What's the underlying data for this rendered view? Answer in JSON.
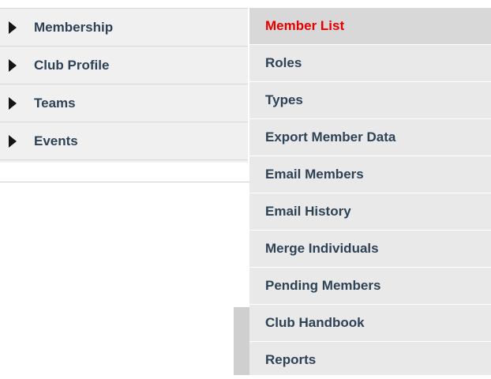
{
  "left_menu": {
    "items": [
      {
        "label": "Membership"
      },
      {
        "label": "Club Profile"
      },
      {
        "label": "Teams"
      },
      {
        "label": "Events"
      }
    ]
  },
  "submenu": {
    "items": [
      {
        "label": "Member List",
        "active": true
      },
      {
        "label": "Roles"
      },
      {
        "label": "Types"
      },
      {
        "label": "Export Member Data"
      },
      {
        "label": "Email Members"
      },
      {
        "label": "Email History"
      },
      {
        "label": "Merge Individuals"
      },
      {
        "label": "Pending Members"
      },
      {
        "label": "Club Handbook"
      },
      {
        "label": "Reports"
      }
    ]
  },
  "colors": {
    "active_text": "#e60000",
    "menu_text": "#2e4256",
    "arrow": "#151515"
  },
  "icons": {
    "left_item_marker": "triangle-right-icon"
  }
}
